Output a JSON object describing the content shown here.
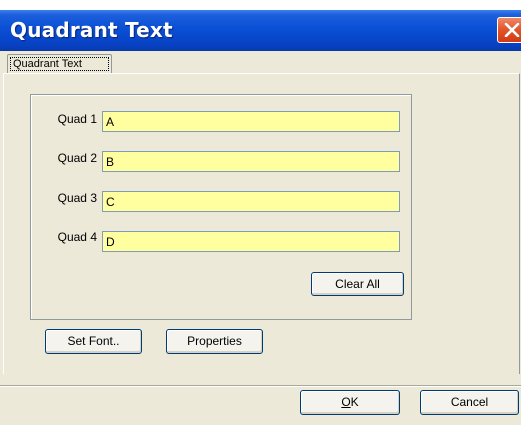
{
  "window": {
    "title": "Quadrant Text"
  },
  "tabs": [
    {
      "label": "Quadrant Text"
    }
  ],
  "quadrants": [
    {
      "label": "Quad 1",
      "value": "A"
    },
    {
      "label": "Quad 2",
      "value": "B"
    },
    {
      "label": "Quad 3",
      "value": "C"
    },
    {
      "label": "Quad 4",
      "value": "D"
    }
  ],
  "buttons": {
    "clear_all": "Clear All",
    "set_font": "Set Font..",
    "properties": "Properties",
    "ok_mnemonic": "O",
    "ok_rest": "K",
    "cancel": "Cancel"
  },
  "colors": {
    "input_bg": "#ffffa0",
    "titlebar": "#0a50d6",
    "dialog_bg": "#ece9d8"
  }
}
